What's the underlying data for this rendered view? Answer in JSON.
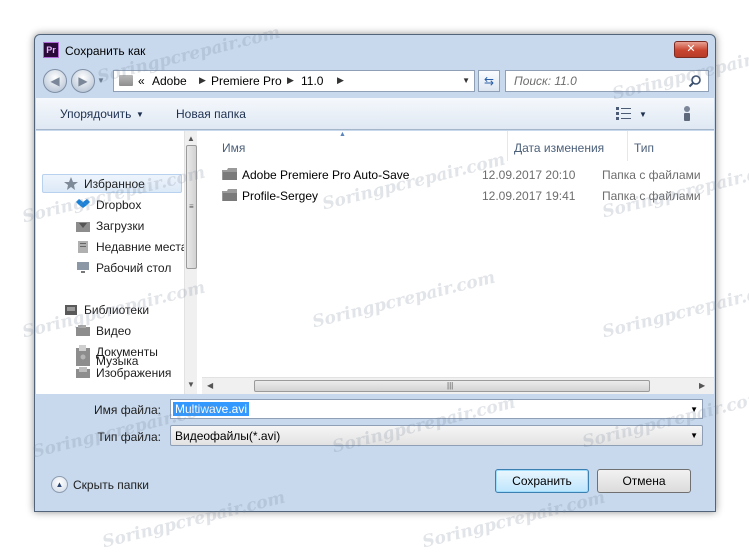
{
  "window": {
    "title": "Сохранить как",
    "app_icon_text": "Pr",
    "close_label": "✕"
  },
  "address": {
    "overflow": "«",
    "path": [
      "Adobe",
      "Premiere Pro",
      "11.0"
    ]
  },
  "search": {
    "placeholder": "Поиск: 11.0"
  },
  "toolbar": {
    "organize_label": "Упорядочить",
    "new_folder_label": "Новая папка"
  },
  "sidebar": {
    "favorites": {
      "label": "Избранное",
      "items": [
        {
          "label": "Dropbox",
          "icon": "dropbox-icon"
        },
        {
          "label": "Загрузки",
          "icon": "downloads-icon"
        },
        {
          "label": "Недавние места",
          "icon": "recent-places-icon"
        },
        {
          "label": "Рабочий стол",
          "icon": "desktop-icon"
        }
      ]
    },
    "libraries": {
      "label": "Библиотеки",
      "items": [
        {
          "label": "Видео",
          "icon": "video-library-icon"
        },
        {
          "label": "Документы",
          "icon": "documents-library-icon"
        },
        {
          "label": "Изображения",
          "icon": "pictures-library-icon"
        },
        {
          "label": "Музыка",
          "icon": "music-library-icon"
        }
      ]
    }
  },
  "file_list": {
    "columns": [
      "Имя",
      "Дата изменения",
      "Тип"
    ],
    "rows": [
      {
        "name": "Adobe Premiere Pro Auto-Save",
        "date": "12.09.2017 20:10",
        "type": "Папка с файлами"
      },
      {
        "name": "Profile-Sergey",
        "date": "12.09.2017 19:41",
        "type": "Папка с файлами"
      }
    ]
  },
  "form": {
    "filename_label": "Имя файла:",
    "filename_value": "Multiwave.avi",
    "filetype_label": "Тип файла:",
    "filetype_value": "Видеофайлы(*.avi)"
  },
  "footer": {
    "hide_folders_label": "Скрыть папки",
    "save_label": "Сохранить",
    "cancel_label": "Отмена"
  },
  "watermark_text": "Soringpcrepair.com",
  "colors": {
    "window_frame": "#c8d9ed",
    "selection": "#3399ff",
    "close_button": "#c8452f",
    "default_button": "#bee6fd"
  }
}
